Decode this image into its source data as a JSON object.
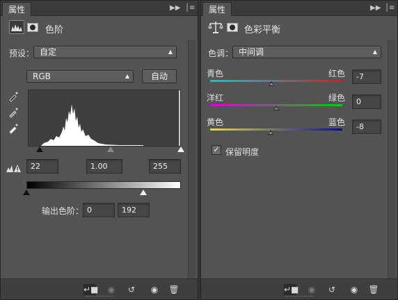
{
  "levels_panel": {
    "tab_title": "属性",
    "header_title": "色阶",
    "preset": {
      "label": "预设：",
      "value": "自定"
    },
    "channel": {
      "value": "RGB"
    },
    "auto_label": "自动",
    "input_levels": {
      "black": "22",
      "gamma": "1.00",
      "white": "255"
    },
    "output_levels": {
      "label": "输出色阶：",
      "black": "0",
      "white": "192"
    },
    "black_point_input": 22,
    "white_point_input": 255,
    "output_white": 192
  },
  "color_balance_panel": {
    "tab_title": "属性",
    "header_title": "色彩平衡",
    "tone": {
      "label": "色调：",
      "value": "中间调"
    },
    "sliders": [
      {
        "left": "青色",
        "right": "红色",
        "value": "-7",
        "num": -7,
        "colors": [
          "#00c8e0",
          "#e01818"
        ]
      },
      {
        "left": "洋红",
        "right": "绿色",
        "value": "0",
        "num": 0,
        "colors": [
          "#e000e0",
          "#00d000"
        ]
      },
      {
        "left": "黄色",
        "right": "蓝色",
        "value": "-8",
        "num": -8,
        "colors": [
          "#e8e800",
          "#0000d8"
        ]
      }
    ],
    "preserve_luminosity": {
      "label": "保留明度",
      "checked": true
    }
  }
}
